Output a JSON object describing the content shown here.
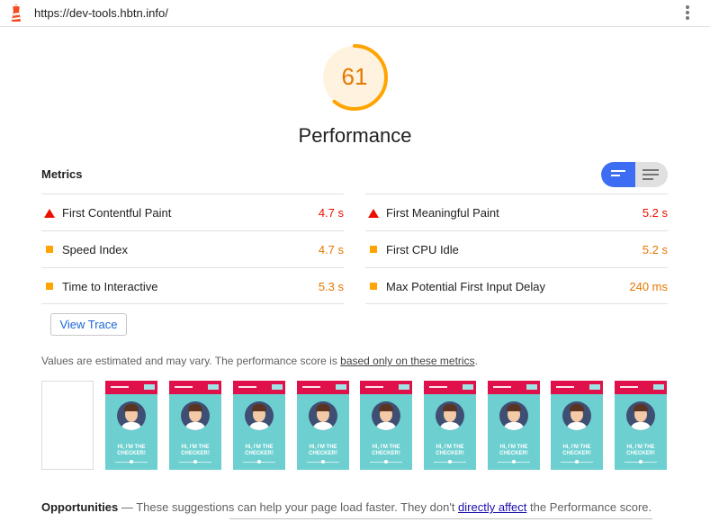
{
  "browser": {
    "url": "https://dev-tools.hbtn.info/"
  },
  "score": {
    "value": "61",
    "fraction": 0.61,
    "color": "#ffa400",
    "category": "Performance"
  },
  "metrics": {
    "title": "Metrics",
    "left": [
      {
        "name": "First Contentful Paint",
        "value": "4.7 s",
        "status": "fail",
        "icon": "triangle-icon"
      },
      {
        "name": "Speed Index",
        "value": "4.7 s",
        "status": "average",
        "icon": "square-icon"
      },
      {
        "name": "Time to Interactive",
        "value": "5.3 s",
        "status": "average",
        "icon": "square-icon"
      }
    ],
    "right": [
      {
        "name": "First Meaningful Paint",
        "value": "5.2 s",
        "status": "fail",
        "icon": "triangle-icon"
      },
      {
        "name": "First CPU Idle",
        "value": "5.2 s",
        "status": "average",
        "icon": "square-icon"
      },
      {
        "name": "Max Potential First Input Delay",
        "value": "240 ms",
        "status": "average",
        "icon": "square-icon"
      }
    ],
    "view_trace_label": "View Trace",
    "toggle": {
      "selected": "compact-view",
      "options": [
        "compact-view-icon",
        "expanded-view-icon"
      ]
    }
  },
  "note": {
    "prefix": "Values are estimated and may vary. The performance score is ",
    "link": "based only on these metrics",
    "suffix": "."
  },
  "filmstrip": {
    "frame_text_line1": "HI, I'M THE",
    "frame_text_line2": "CHECKER!"
  },
  "opportunities": {
    "title": "Opportunities",
    "dash": "—",
    "text_before": "These suggestions can help your page load faster. They don't ",
    "link": "directly affect",
    "text_after": " the Performance score."
  },
  "colors": {
    "fail": "#eb0f00",
    "average": "#ffa400",
    "toggle_active": "#3d6df2",
    "link": "#1a0dab"
  }
}
